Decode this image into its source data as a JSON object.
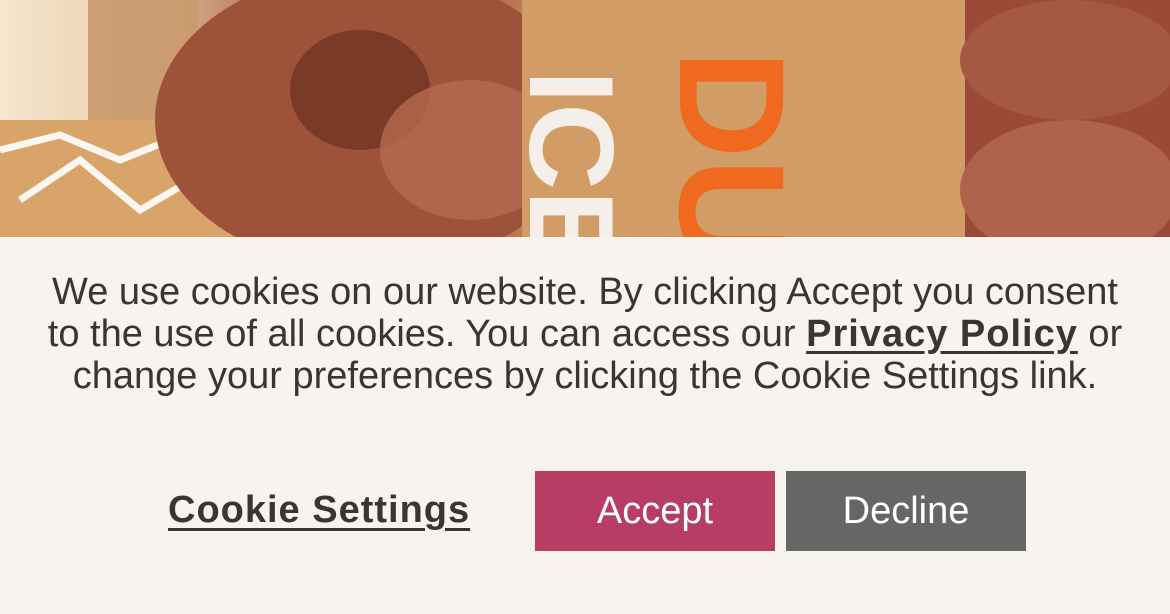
{
  "hero": {
    "cup_text_left": "ICE",
    "cup_text_right": "DU"
  },
  "banner": {
    "message_part1": "We use cookies on our website. By clicking Accept you consent to the use of all cookies. You can access our ",
    "privacy_link": "Privacy Policy",
    "message_part2": " or change your preferences by clicking the Cookie Settings link.",
    "cookie_settings_label": "Cookie Settings",
    "accept_label": "Accept",
    "decline_label": "Decline"
  },
  "colors": {
    "accept": "#b83d64",
    "decline": "#666666",
    "text": "#3d3431",
    "background": "#f7f3ef"
  }
}
